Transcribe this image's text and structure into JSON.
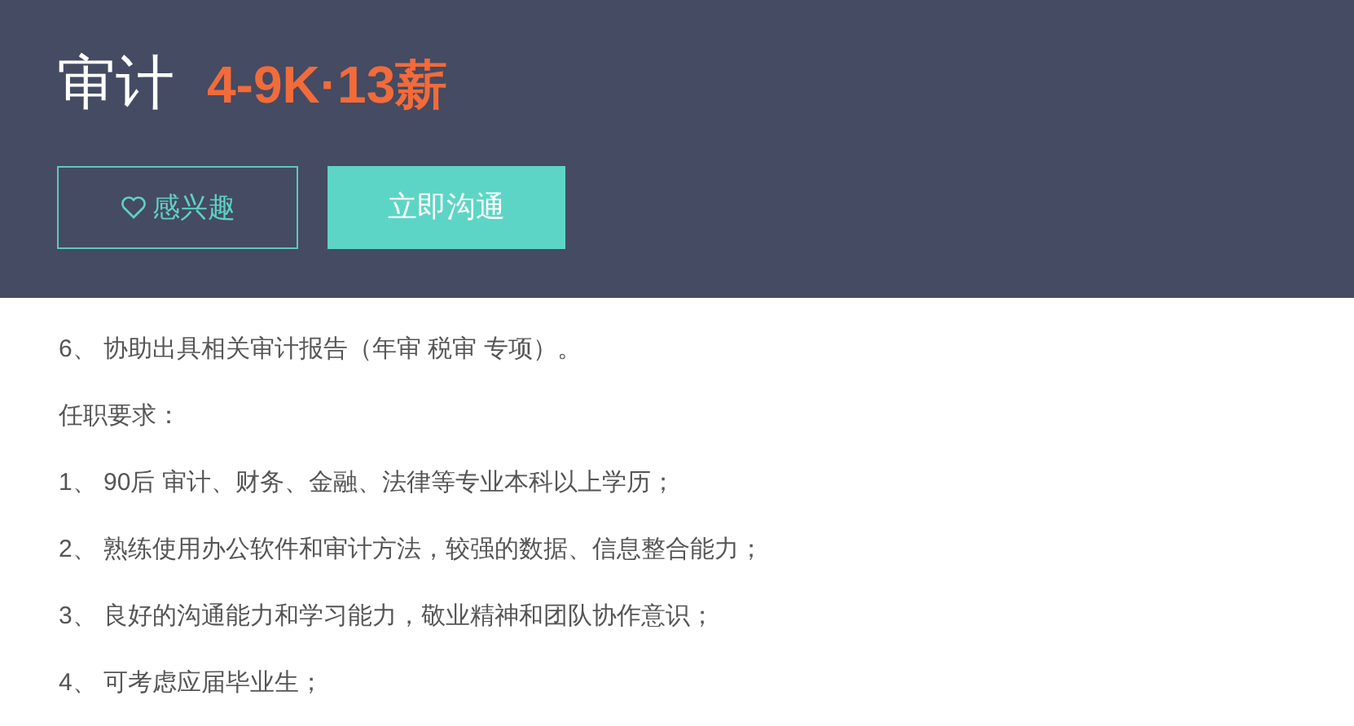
{
  "header": {
    "title": "审计",
    "salary": "4-9K·13薪",
    "buttons": [
      {
        "kind": "outline",
        "label": "感兴趣"
      },
      {
        "kind": "primary",
        "label": "立即沟通"
      }
    ]
  },
  "description": [
    "6、 协助出具相关审计报告（年审 税审 专项）。",
    "任职要求：",
    "1、 90后 审计、财务、金融、法律等专业本科以上学历；",
    "2、 熟练使用办公软件和审计方法，较强的数据、信息整合能力；",
    "3、 良好的沟通能力和学习能力，敬业精神和团队协作意识；",
    "4、 可考虑应届毕业生；"
  ]
}
